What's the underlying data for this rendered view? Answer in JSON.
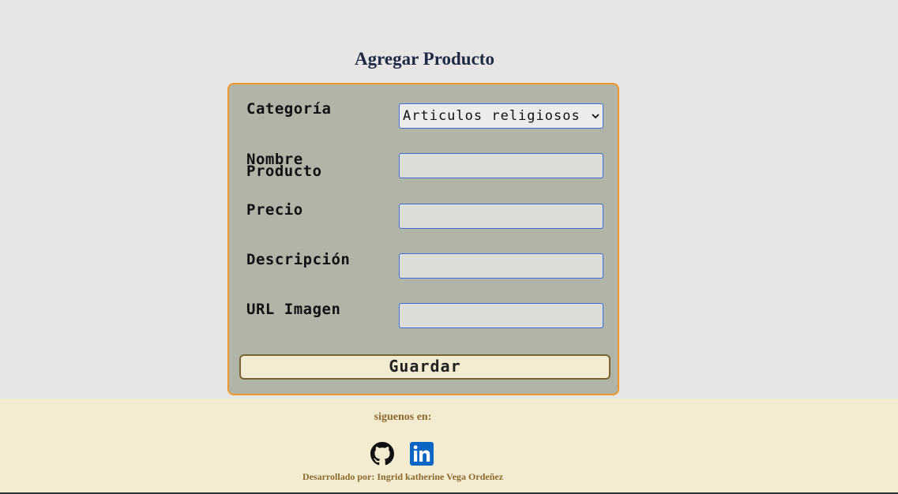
{
  "page": {
    "title": "Agregar Producto"
  },
  "form": {
    "category": {
      "label": "Categoría",
      "selected_value": "Articulos religiosos"
    },
    "product_name": {
      "label_line1": "Nombre",
      "label_line2": "Producto",
      "value": ""
    },
    "price": {
      "label": "Precio",
      "value": ""
    },
    "description": {
      "label": "Descripción",
      "value": ""
    },
    "image_url": {
      "label": "URL Imagen",
      "value": ""
    },
    "save_label": "Guardar"
  },
  "footer": {
    "follow_text": "siguenos en:",
    "icons": [
      "github-icon",
      "linkedin-icon"
    ],
    "credit_text": "Desarrollado por: Ingrid katherine Vega Ordeñez"
  },
  "colors": {
    "background": "#e6e6e6",
    "form_background": "#b0b5a8",
    "form_border": "#f0962a",
    "input_border": "#3d6be0",
    "button_background": "#f3ecd2",
    "footer_background": "#f3ecd1",
    "footer_text": "#8b6a2e",
    "title_text": "#1f2a44",
    "linkedin_blue": "#0a66c2"
  }
}
